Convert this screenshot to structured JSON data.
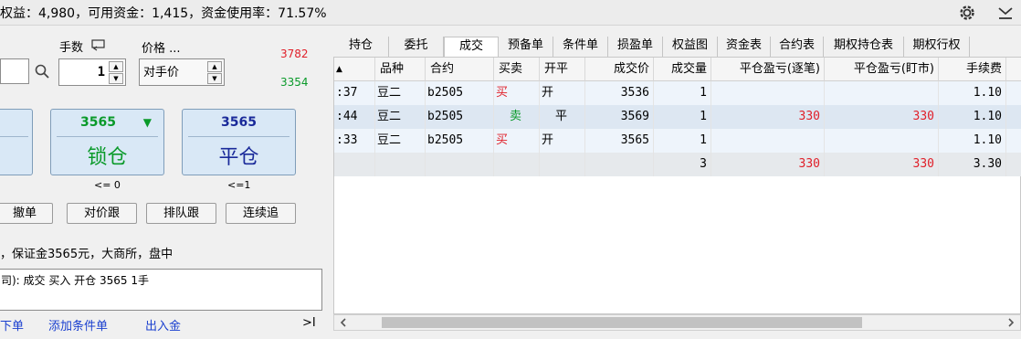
{
  "header": {
    "summary": "权益：4,980，可用资金：1,415，资金使用率：71.57%",
    "icons": [
      "gear-icon",
      "collapse-icon"
    ]
  },
  "order_panel": {
    "qty_label": "手数",
    "price_label": "价格 ...",
    "qty_value": "1",
    "price_mode": "对手价",
    "upper_limit": "3782",
    "lower_limit": "3354",
    "lock_button": {
      "price": "3565",
      "arrow": "▼",
      "label": "锁仓",
      "note": "<= 0"
    },
    "close_button": {
      "price": "3565",
      "label": "平仓",
      "note": "<=1"
    },
    "buttons": {
      "cancel": "撤单",
      "follow_opp": "对价跟",
      "follow_queue": "排队跟",
      "chase": "连续追"
    },
    "info_line": "，保证金3565元，大商所，盘中",
    "log_text": "司): 成交 买入 开仓 3565 1手",
    "links": {
      "order": "下单",
      "add_condition": "添加条件单",
      "transfer": "出入金"
    },
    "expand": ">I"
  },
  "tabs": [
    "持仓",
    "委托",
    "成交",
    "预备单",
    "条件单",
    "损盈单",
    "权益图",
    "资金表",
    "合约表",
    "期权持仓表",
    "期权行权"
  ],
  "active_tab": "成交",
  "grid": {
    "columns": [
      "",
      "品种",
      "合约",
      "买卖",
      "开平",
      "成交价",
      "成交量",
      "平仓盈亏(逐笔)",
      "平仓盈亏(盯市)",
      "手续费"
    ],
    "rows": [
      {
        "time": ":37",
        "variety": "豆二",
        "contract": "b2505",
        "side": "买",
        "openclose": "开",
        "price": "3536",
        "qty": "1",
        "pnl_trade": "",
        "pnl_mtm": "",
        "fee": "1.10"
      },
      {
        "time": ":44",
        "variety": "豆二",
        "contract": "b2505",
        "side": "卖",
        "openclose": "平",
        "price": "3569",
        "qty": "1",
        "pnl_trade": "330",
        "pnl_mtm": "330",
        "fee": "1.10"
      },
      {
        "time": ":33",
        "variety": "豆二",
        "contract": "b2505",
        "side": "买",
        "openclose": "开",
        "price": "3565",
        "qty": "1",
        "pnl_trade": "",
        "pnl_mtm": "",
        "fee": "1.10"
      }
    ],
    "total": {
      "qty": "3",
      "pnl_trade": "330",
      "pnl_mtm": "330",
      "fee": "3.30"
    }
  },
  "colors": {
    "buy": "#e0202a",
    "sell": "#0a9a2a",
    "link": "#1a3fcf",
    "button_bg": "#d9e8f6"
  }
}
